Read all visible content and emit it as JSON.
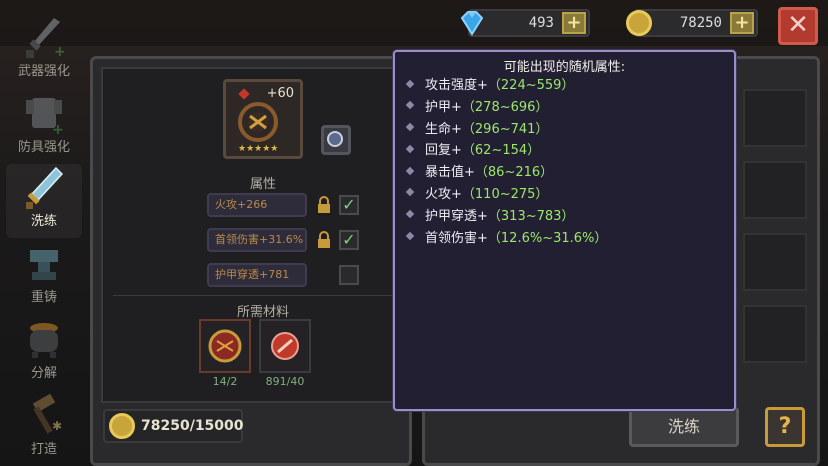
{
  "currencies": {
    "gems": "493",
    "gold": "78250",
    "plus_symbol": "+"
  },
  "close_symbol": "✕",
  "sidenav": {
    "items": [
      {
        "label": "武器强化",
        "icon": "sword-icon"
      },
      {
        "label": "防具强化",
        "icon": "armor-icon"
      },
      {
        "label": "洗练",
        "icon": "refine-blade-icon",
        "active": true
      },
      {
        "label": "重铸",
        "icon": "anvil-icon"
      },
      {
        "label": "分解",
        "icon": "cauldron-icon"
      },
      {
        "label": "打造",
        "icon": "hammer-icon"
      }
    ]
  },
  "item": {
    "level": "+60",
    "stars": "★★★★★"
  },
  "attributes": {
    "title": "属性",
    "rows": [
      {
        "text": "火攻+266",
        "locked": true,
        "checked": true
      },
      {
        "text": "首领伤害+31.6%",
        "locked": true,
        "checked": true
      },
      {
        "text": "护甲穿透+781",
        "locked": false,
        "checked": false
      }
    ]
  },
  "materials": {
    "title": "所需材料",
    "items": [
      {
        "count": "14/2",
        "icon": "red-rune-stone-icon"
      },
      {
        "count": "891/40",
        "icon": "red-scroll-icon"
      }
    ]
  },
  "gold_cost": "78250/15000",
  "action_button": "洗练",
  "help_button": "?",
  "popup": {
    "title": "可能出现的随机属性:",
    "rows": [
      {
        "name": "攻击强度+",
        "range": "（224~559）"
      },
      {
        "name": "护甲+",
        "range": "（278~696）"
      },
      {
        "name": "生命+",
        "range": "（296~741）"
      },
      {
        "name": "回复+",
        "range": "（62~154）"
      },
      {
        "name": "暴击值+",
        "range": "（86~216）"
      },
      {
        "name": "火攻+",
        "range": "（110~275）"
      },
      {
        "name": "护甲穿透+",
        "range": "（313~783）"
      },
      {
        "name": "首领伤害+",
        "range": "（12.6%~31.6%）"
      }
    ]
  },
  "colors": {
    "range_green": "#9be86a",
    "popup_border": "#9a8fc8",
    "close_red": "#b23a2e",
    "attr_orange": "#b98a4a"
  }
}
